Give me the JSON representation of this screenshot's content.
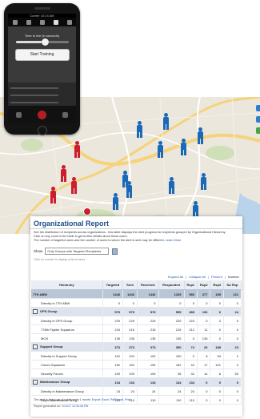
{
  "phone": {
    "status": "Carrier 10:24 AM",
    "slider_label": "Time to live (in seconds)",
    "slider_value": 0.55,
    "start_button": "Start Training"
  },
  "map": {
    "pin_colors": {
      "recipient_ok": "#1a6ab8",
      "recipient_alert": "#cc1e2c"
    }
  },
  "report": {
    "title": "Organizational Report",
    "description_1": "See the distribution of recipients across organizations - this table displays the alert progress for recipients grouped by Organizational Hierarchy.",
    "description_2": "Click on any count in the table to get further details about those users.",
    "description_3": "The number of targeted users and the number of users to whom the alert is sent may be different.",
    "learn_more": "Learn More",
    "show_label": "Show",
    "show_value": "Only Groups with Targeted Recipients",
    "hint": "Click on number to display a list of users",
    "links": {
      "expand": "Expand All",
      "collapse": "Collapse All",
      "percent": "Percent",
      "number": "Number"
    },
    "columns": [
      "Hierarchy",
      "Targeted",
      "Sent",
      "Received",
      "Responded",
      "Rsp1",
      "Rsp2",
      "Rsp3",
      "No Rsp"
    ],
    "rows": [
      {
        "type": "total",
        "cells": [
          "7TH ABW",
          "1446",
          "1446",
          "1446",
          "1325",
          "580",
          "377",
          "185",
          "121"
        ]
      },
      {
        "type": "child",
        "cells": [
          "Directly in 7TH ABW",
          "0",
          "0",
          "0",
          "0",
          "0",
          "0",
          "0",
          "0"
        ]
      },
      {
        "type": "grp",
        "toggle": "-",
        "cells": [
          "OPS Group",
          "579",
          "579",
          "579",
          "555",
          "385",
          "190",
          "6",
          "24"
        ]
      },
      {
        "type": "child",
        "cells": [
          "Directly in OPS Group",
          "229",
          "229",
          "229",
          "229",
          "223",
          "0",
          "0",
          "0"
        ]
      },
      {
        "type": "child",
        "cells": [
          "778th Fighter Squadron",
          "215",
          "215",
          "215",
          "215",
          "212",
          "11",
          "0",
          "0"
        ]
      },
      {
        "type": "child",
        "cells": [
          "MOS",
          "135",
          "135",
          "135",
          "135",
          "0",
          "135",
          "0",
          "0"
        ]
      },
      {
        "type": "grp",
        "toggle": "-",
        "cells": [
          "Support Group",
          "373",
          "373",
          "373",
          "350",
          "74",
          "20",
          "188",
          "23"
        ]
      },
      {
        "type": "child",
        "cells": [
          "Directly in Support Group",
          "102",
          "102",
          "102",
          "100",
          "0",
          "8",
          "94",
          "2"
        ]
      },
      {
        "type": "child",
        "cells": [
          "Comm Squadron",
          "152",
          "152",
          "152",
          "152",
          "42",
          "17",
          "101",
          "0"
        ]
      },
      {
        "type": "child",
        "cells": [
          "Security Forces",
          "109",
          "109",
          "109",
          "35",
          "32",
          "14",
          "8",
          "53"
        ]
      },
      {
        "type": "grp",
        "toggle": "-",
        "cells": [
          "Maintenance Group",
          "134",
          "134",
          "134",
          "134",
          "134",
          "0",
          "0",
          "0"
        ]
      },
      {
        "type": "child",
        "cells": [
          "Directly in Maintenance Group",
          "24",
          "24",
          "24",
          "24",
          "24",
          "0",
          "0",
          "0"
        ]
      },
      {
        "type": "child",
        "cells": [
          "Depot Maintenance Wing",
          "110",
          "110",
          "110",
          "110",
          "110",
          "0",
          "0",
          "0"
        ]
      }
    ],
    "footer_1": "The alert is back-ups of public entry 1 month:",
    "footer_1_links": "Export: Excel, PdfReport, Print",
    "footer_2": "Report generated on:",
    "footer_2_link": "1/12/17 12:34:36 PM"
  }
}
